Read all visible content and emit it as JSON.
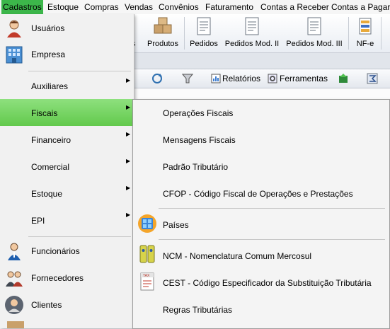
{
  "menubar": {
    "items": [
      "Cadastros",
      "Estoque",
      "Compras",
      "Vendas",
      "Convênios",
      "Faturamento",
      "Contas a Receber",
      "Contas a Pagar"
    ],
    "active_color": "#3cb64a"
  },
  "toolbar": {
    "partial_label": "s",
    "buttons": [
      {
        "label": "Produtos",
        "icon": "boxes-icon"
      },
      {
        "label": "Pedidos",
        "icon": "document-icon"
      },
      {
        "label": "Pedidos Mod. II",
        "icon": "document-icon"
      },
      {
        "label": "Pedidos Mod. III",
        "icon": "document-icon"
      },
      {
        "label": "NF-e",
        "icon": "nfe-icon"
      }
    ]
  },
  "toolbar2": {
    "relatorios": "Relatórios",
    "ferramentas": "Ferramentas"
  },
  "dropdown": {
    "items": [
      {
        "label": "Usuários",
        "icon": "user-icon"
      },
      {
        "label": "Empresa",
        "icon": "building-icon"
      },
      {
        "label": "Auxiliares"
      },
      {
        "label": "Fiscais"
      },
      {
        "label": "Financeiro"
      },
      {
        "label": "Comercial"
      },
      {
        "label": "Estoque"
      },
      {
        "label": "EPI"
      },
      {
        "label": "Funcionários",
        "icon": "employees-icon"
      },
      {
        "label": "Fornecedores",
        "icon": "suppliers-icon"
      },
      {
        "label": "Clientes",
        "icon": "client-icon"
      }
    ],
    "highlight_color": "#6fd058"
  },
  "submenu": {
    "items": [
      {
        "label": "Operações Fiscais"
      },
      {
        "label": "Mensagens Fiscais"
      },
      {
        "label": "Padrão Tributário"
      },
      {
        "label": "CFOP - Código Fiscal de Operações e Prestações"
      },
      {
        "label": "Países",
        "icon": "countries-icon"
      },
      {
        "label": "NCM - Nomenclatura Comum Mercosul",
        "icon": "binders-icon"
      },
      {
        "label": "CEST - Código Especificador da Substituição Tributária",
        "icon": "tax-document-icon"
      },
      {
        "label": "Regras Tributárias"
      }
    ]
  }
}
